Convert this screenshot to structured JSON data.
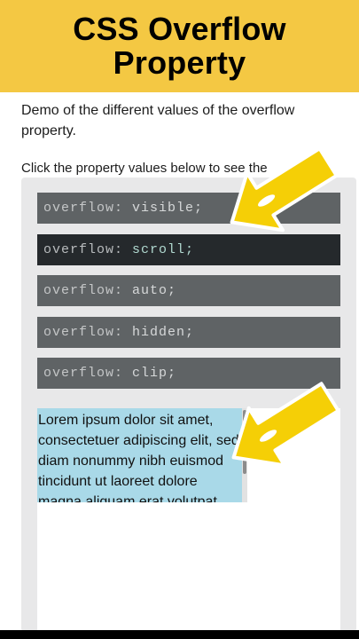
{
  "banner": {
    "title_line1": "CSS Overflow",
    "title_line2": "Property",
    "color": "#f4c843"
  },
  "intro": "Demo of the different values of the overflow property.",
  "hint": "Click the property values below to see the",
  "options": [
    {
      "prop": "overflow:",
      "value": "visible;",
      "active": false
    },
    {
      "prop": "overflow:",
      "value": "scroll;",
      "active": true
    },
    {
      "prop": "overflow:",
      "value": "auto;",
      "active": false
    },
    {
      "prop": "overflow:",
      "value": "hidden;",
      "active": false
    },
    {
      "prop": "overflow:",
      "value": "clip;",
      "active": false
    }
  ],
  "result": {
    "text": "Lorem ipsum dolor sit amet, consectetuer adipiscing elit, sed diam nonummy nibh euismod tincidunt ut laoreet dolore magna aliquam erat volutpat.",
    "background": "#a9d9e8"
  },
  "annotations": {
    "arrow_color": "#f5cf06",
    "arrow_icon": "pointing-arrow-icon"
  }
}
